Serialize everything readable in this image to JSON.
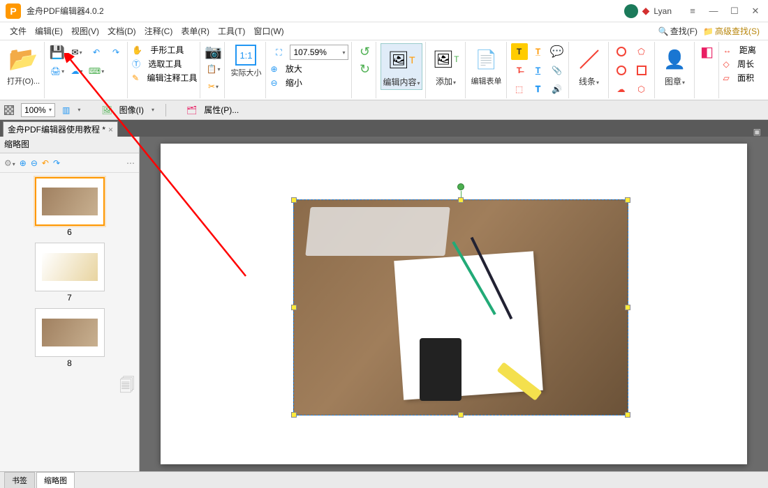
{
  "app": {
    "title": "金舟PDF编辑器4.0.2",
    "user": "Lyan"
  },
  "menus": {
    "file": "文件",
    "edit": "编辑(E)",
    "view": "视图(V)",
    "document": "文档(D)",
    "comment": "注释(C)",
    "form": "表单(R)",
    "tools": "工具(T)",
    "window": "窗口(W)",
    "find": "查找(F)",
    "advfind": "高级查找(S)"
  },
  "toolbar": {
    "open": "打开(O)...",
    "hand": "手形工具",
    "select": "选取工具",
    "annot": "编辑注释工具",
    "actual": "实际大小",
    "zoomval": "107.59%",
    "zoomin": "放大",
    "zoomout": "缩小",
    "editcontent": "编辑内容",
    "add": "添加",
    "editform": "编辑表单",
    "lines": "线条",
    "stamp": "图章",
    "distance": "距离",
    "perimeter": "周长",
    "area": "面积"
  },
  "subbar": {
    "zoom": "100%",
    "image": "图像(I)",
    "props": "属性(P)..."
  },
  "doc": {
    "tab": "金舟PDF编辑器使用教程 *"
  },
  "side": {
    "title": "缩略图",
    "p6": "6",
    "p7": "7",
    "p8": "8"
  },
  "bottom": {
    "bookmark": "书签",
    "thumbs": "缩略图"
  }
}
